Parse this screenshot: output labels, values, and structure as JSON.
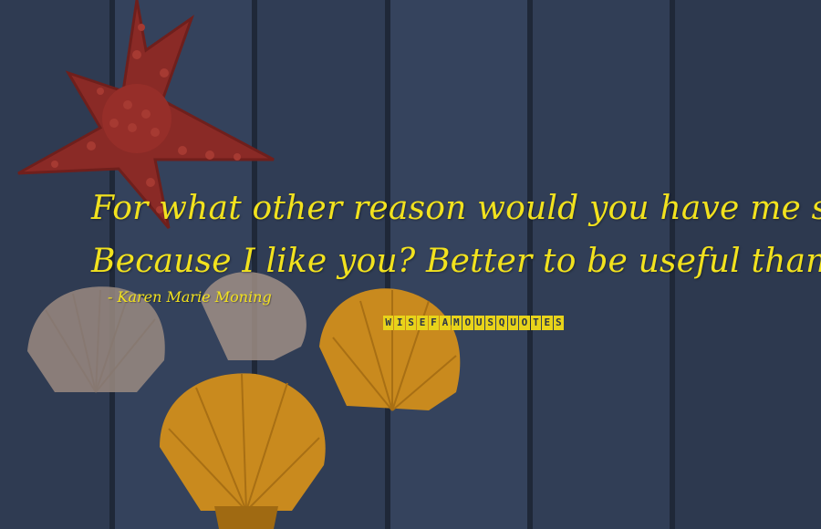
{
  "quote": {
    "line1": "For what other reason would you have me save you?",
    "line2": "Because I like you? Better to be useful than liked."
  },
  "author": "- Karen Marie Moning",
  "watermark": "WISEFAMOUSQUOTES",
  "colors": {
    "text": "#f2e21e",
    "background": "#2e3a50",
    "starfish": "#8a2a26",
    "shell_orange": "#c98a1e",
    "shell_pale": "#9a8a80"
  },
  "scene": {
    "objects": [
      "starfish",
      "scallop-shell-pale-left",
      "scallop-shell-pale-center",
      "scallop-shell-orange-right",
      "scallop-shell-orange-bottom"
    ]
  }
}
